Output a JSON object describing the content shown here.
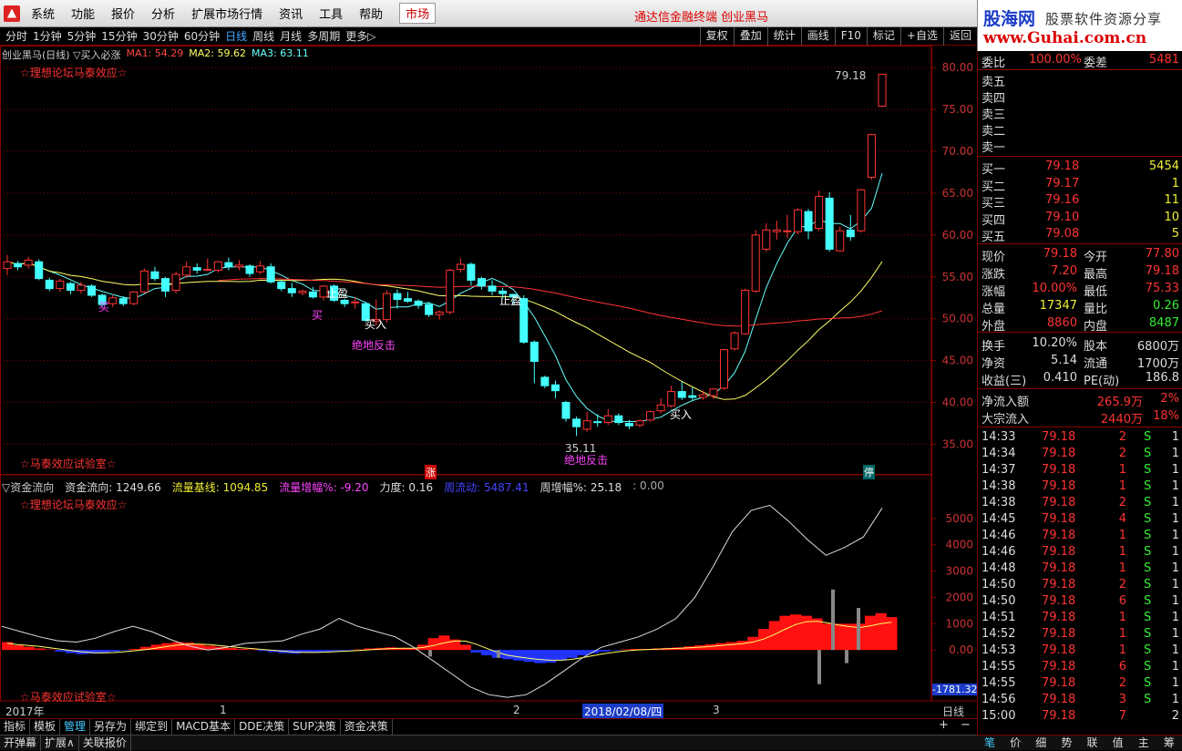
{
  "menubar": {
    "items": [
      "系统",
      "功能",
      "报价",
      "分析",
      "扩展市场行情",
      "资讯",
      "工具",
      "帮助"
    ],
    "active": "市场",
    "center_title": "通达信金融终端  创业黑马"
  },
  "brand": {
    "line1": "股海网",
    "line2": "股票软件资源分享",
    "line3": "www.Guhai.com.cn"
  },
  "toolbar": {
    "periods": [
      "分时",
      "1分钟",
      "5分钟",
      "15分钟",
      "30分钟",
      "60分钟",
      "日线",
      "周线",
      "月线",
      "多周期",
      "更多▷"
    ],
    "selected": "日线",
    "buttons": [
      "复权",
      "叠加",
      "统计",
      "画线",
      "F10",
      "标记",
      "+自选",
      "返回"
    ]
  },
  "main_chart": {
    "title": "创业黑马(日线) ▽买入必涨",
    "ma1": "MA1: 54.29",
    "ma2": "MA2: 59.62",
    "ma3": "MA3: 63.11",
    "tag_top": "☆理想论坛马泰效应☆",
    "tag_bottom": "☆马泰效应试验室☆",
    "high_label": "79.18",
    "low_label": "35.11",
    "annotations": [
      {
        "text": "止盈",
        "color": "#ffffff"
      },
      {
        "text": "止盈",
        "color": "#ffffff"
      },
      {
        "text": "买入",
        "color": "#ffffff"
      },
      {
        "text": "买入",
        "color": "#ffffff"
      },
      {
        "text": "绝地反击",
        "color": "#ff44ff"
      },
      {
        "text": "绝地反击",
        "color": "#ff44ff"
      },
      {
        "text": "买",
        "color": "#ff44ff"
      },
      {
        "text": "买",
        "color": "#ff44ff"
      }
    ],
    "mark_zhang": "涨",
    "mark_ting": "停",
    "y_labels": [
      "80.00",
      "75.00",
      "70.00",
      "65.00",
      "60.00",
      "55.00",
      "50.00",
      "45.00",
      "40.00",
      "35.00"
    ]
  },
  "sub_chart": {
    "title": "▽资金流向",
    "v1": "资金流向: 1249.66",
    "v2": "流量基线: 1094.85",
    "v3": "流量增幅%: -9.20",
    "v4": "力度: 0.16",
    "v5": "周流动: 5487.41",
    "v6": "周增幅%: 25.18",
    "v7": ": 0.00",
    "tag_top": "☆理想论坛马泰效应☆",
    "tag_bottom": "☆马泰效应试验室☆",
    "y_labels": [
      "5000",
      "4000",
      "3000",
      "2000",
      "1000",
      "0.00"
    ],
    "neg_label": "-1781.32"
  },
  "time_axis": {
    "labels": [
      "2017年",
      "1",
      "2",
      "2018/02/08/四",
      "3"
    ],
    "period": "日线"
  },
  "bottom_tabs": [
    "指标",
    "模板",
    "管理",
    "另存为",
    "绑定到",
    "MACD基本",
    "DDE决策",
    "SUP决策",
    "资金决策"
  ],
  "bottom_tabs_selected": "管理",
  "bottom_row2": [
    "开弹幕",
    "扩展∧",
    "关联报价"
  ],
  "quote": {
    "weibi": {
      "label": "委比",
      "value": "100.00%",
      "label2": "委差",
      "value2": "5481"
    },
    "asks": [
      {
        "label": "卖五"
      },
      {
        "label": "卖四"
      },
      {
        "label": "卖三"
      },
      {
        "label": "卖二"
      },
      {
        "label": "卖一"
      }
    ],
    "bids": [
      {
        "label": "买一",
        "price": "79.18",
        "vol": "5454"
      },
      {
        "label": "买二",
        "price": "79.17",
        "vol": "1"
      },
      {
        "label": "买三",
        "price": "79.16",
        "vol": "11"
      },
      {
        "label": "买四",
        "price": "79.10",
        "vol": "10"
      },
      {
        "label": "买五",
        "price": "79.08",
        "vol": "5"
      }
    ],
    "stats": [
      {
        "l1": "现价",
        "v1": "79.18",
        "c1": "red",
        "l2": "今开",
        "v2": "77.80",
        "c2": "red"
      },
      {
        "l1": "涨跌",
        "v1": "7.20",
        "c1": "red",
        "l2": "最高",
        "v2": "79.18",
        "c2": "red"
      },
      {
        "l1": "涨幅",
        "v1": "10.00%",
        "c1": "red",
        "l2": "最低",
        "v2": "75.33",
        "c2": "red"
      },
      {
        "l1": "总量",
        "v1": "17347",
        "c1": "yel",
        "l2": "量比",
        "v2": "0.26",
        "c2": "grn"
      },
      {
        "l1": "外盘",
        "v1": "8860",
        "c1": "red",
        "l2": "内盘",
        "v2": "8487",
        "c2": "grn"
      }
    ],
    "stats2": [
      {
        "l1": "换手",
        "v1": "10.20%",
        "l2": "股本",
        "v2": "6800万"
      },
      {
        "l1": "净资",
        "v1": "5.14",
        "l2": "流通",
        "v2": "1700万"
      },
      {
        "l1": "收益(三)",
        "v1": "0.410",
        "l2": "PE(动)",
        "v2": "186.8"
      }
    ],
    "flows": [
      {
        "label": "净流入额",
        "value": "265.9万",
        "pct": "2%"
      },
      {
        "label": "大宗流入",
        "value": "2440万",
        "pct": "18%"
      }
    ],
    "ticks": [
      {
        "t": "14:33",
        "p": "79.18",
        "v": "2",
        "s": "S",
        "n": "1"
      },
      {
        "t": "14:34",
        "p": "79.18",
        "v": "2",
        "s": "S",
        "n": "1"
      },
      {
        "t": "14:37",
        "p": "79.18",
        "v": "1",
        "s": "S",
        "n": "1"
      },
      {
        "t": "14:38",
        "p": "79.18",
        "v": "1",
        "s": "S",
        "n": "1"
      },
      {
        "t": "14:38",
        "p": "79.18",
        "v": "2",
        "s": "S",
        "n": "1"
      },
      {
        "t": "14:45",
        "p": "79.18",
        "v": "4",
        "s": "S",
        "n": "1"
      },
      {
        "t": "14:46",
        "p": "79.18",
        "v": "1",
        "s": "S",
        "n": "1"
      },
      {
        "t": "14:46",
        "p": "79.18",
        "v": "1",
        "s": "S",
        "n": "1"
      },
      {
        "t": "14:48",
        "p": "79.18",
        "v": "1",
        "s": "S",
        "n": "1"
      },
      {
        "t": "14:50",
        "p": "79.18",
        "v": "2",
        "s": "S",
        "n": "1"
      },
      {
        "t": "14:50",
        "p": "79.18",
        "v": "6",
        "s": "S",
        "n": "1"
      },
      {
        "t": "14:51",
        "p": "79.18",
        "v": "1",
        "s": "S",
        "n": "1"
      },
      {
        "t": "14:52",
        "p": "79.18",
        "v": "1",
        "s": "S",
        "n": "1"
      },
      {
        "t": "14:53",
        "p": "79.18",
        "v": "1",
        "s": "S",
        "n": "1"
      },
      {
        "t": "14:55",
        "p": "79.18",
        "v": "6",
        "s": "S",
        "n": "1"
      },
      {
        "t": "14:55",
        "p": "79.18",
        "v": "2",
        "s": "S",
        "n": "1"
      },
      {
        "t": "14:56",
        "p": "79.18",
        "v": "3",
        "s": "S",
        "n": "1"
      },
      {
        "t": "15:00",
        "p": "79.18",
        "v": "7",
        "s": "",
        "n": "2"
      }
    ]
  },
  "right_tabs": [
    "笔",
    "价",
    "细",
    "势",
    "联",
    "值",
    "主",
    "筹"
  ],
  "right_tabs_selected": "笔",
  "colors": {
    "up": "#ff3333",
    "down": "#44ffff",
    "ma1": "#ffffff",
    "ma2": "#ffff66",
    "ma3": "#ff3333",
    "grid": "#880000"
  },
  "chart_data": {
    "type": "candlestick",
    "y_range": [
      32,
      81
    ],
    "candles": [
      [
        56.0,
        56.8,
        55.2,
        57.6
      ],
      [
        56.6,
        56.2,
        55.8,
        56.9
      ],
      [
        56.4,
        57.0,
        56.0,
        57.4
      ],
      [
        56.8,
        54.8,
        54.6,
        57.1
      ],
      [
        54.6,
        53.6,
        53.3,
        54.9
      ],
      [
        53.6,
        54.5,
        53.2,
        54.8
      ],
      [
        54.2,
        53.4,
        52.9,
        54.4
      ],
      [
        53.4,
        54.0,
        53.0,
        54.4
      ],
      [
        53.9,
        52.8,
        52.6,
        54.1
      ],
      [
        52.8,
        51.7,
        51.4,
        53.0
      ],
      [
        51.8,
        52.5,
        51.4,
        52.8
      ],
      [
        52.4,
        51.8,
        51.5,
        52.7
      ],
      [
        51.8,
        53.2,
        51.6,
        53.3
      ],
      [
        53.2,
        55.7,
        53.0,
        56.0
      ],
      [
        55.6,
        54.8,
        54.5,
        56.2
      ],
      [
        54.8,
        53.3,
        52.6,
        55.0
      ],
      [
        53.4,
        55.3,
        53.0,
        55.6
      ],
      [
        55.2,
        56.2,
        54.9,
        56.8
      ],
      [
        56.1,
        55.8,
        55.4,
        56.6
      ],
      [
        55.9,
        55.9,
        55.7,
        57.2
      ],
      [
        55.8,
        56.8,
        55.5,
        56.9
      ],
      [
        56.7,
        56.2,
        55.8,
        57.3
      ],
      [
        56.2,
        56.4,
        55.8,
        57.0
      ],
      [
        56.3,
        55.4,
        55.0,
        56.5
      ],
      [
        55.6,
        56.3,
        55.3,
        56.9
      ],
      [
        56.2,
        54.4,
        54.2,
        56.6
      ],
      [
        54.4,
        53.6,
        53.3,
        54.6
      ],
      [
        53.6,
        53.1,
        52.6,
        54.3
      ],
      [
        53.1,
        53.3,
        52.8,
        53.5
      ],
      [
        53.2,
        52.6,
        52.4,
        53.8
      ],
      [
        52.6,
        53.9,
        52.2,
        54.0
      ],
      [
        53.9,
        52.2,
        52.0,
        54.1
      ],
      [
        52.2,
        51.8,
        51.4,
        52.4
      ],
      [
        51.9,
        52.0,
        51.2,
        52.6
      ],
      [
        51.8,
        49.8,
        49.6,
        52.0
      ],
      [
        49.7,
        49.9,
        49.2,
        52.3
      ],
      [
        49.9,
        53.0,
        49.5,
        53.4
      ],
      [
        53.0,
        52.3,
        51.2,
        53.5
      ],
      [
        52.4,
        52.1,
        51.9,
        53.2
      ],
      [
        52.1,
        51.6,
        51.2,
        52.3
      ],
      [
        51.7,
        50.5,
        50.2,
        52.0
      ],
      [
        50.5,
        50.8,
        49.9,
        51.0
      ],
      [
        50.8,
        55.8,
        50.5,
        56.0
      ],
      [
        55.9,
        56.5,
        55.5,
        57.2
      ],
      [
        56.5,
        54.6,
        54.0,
        56.7
      ],
      [
        54.8,
        53.9,
        53.5,
        55.0
      ],
      [
        53.9,
        53.3,
        52.8,
        54.6
      ],
      [
        53.3,
        53.0,
        52.4,
        53.7
      ],
      [
        52.9,
        52.6,
        51.7,
        53.0
      ],
      [
        52.4,
        47.2,
        47.0,
        52.8
      ],
      [
        47.2,
        44.9,
        42.3,
        47.4
      ],
      [
        43.0,
        42.0,
        41.7,
        43.2
      ],
      [
        42.1,
        41.4,
        40.5,
        42.6
      ],
      [
        40.0,
        38.1,
        37.7,
        40.2
      ],
      [
        38.0,
        37.1,
        36.0,
        38.3
      ],
      [
        36.8,
        37.8,
        36.5,
        38.9
      ],
      [
        37.7,
        37.6,
        37.1,
        38.6
      ],
      [
        37.6,
        38.4,
        37.3,
        39.2
      ],
      [
        38.4,
        37.6,
        37.3,
        38.7
      ],
      [
        37.5,
        37.2,
        36.8,
        37.9
      ],
      [
        37.3,
        37.8,
        37.0,
        38.0
      ],
      [
        37.9,
        38.9,
        37.7,
        39.0
      ],
      [
        39.0,
        39.7,
        38.7,
        40.5
      ],
      [
        39.6,
        41.3,
        39.4,
        42.0
      ],
      [
        41.3,
        40.6,
        40.3,
        42.5
      ],
      [
        40.8,
        40.6,
        40.3,
        41.8
      ],
      [
        40.6,
        40.9,
        40.3,
        41.4
      ],
      [
        40.8,
        41.6,
        40.4,
        41.7
      ],
      [
        41.7,
        46.3,
        41.5,
        46.4
      ],
      [
        46.4,
        48.3,
        46.2,
        48.5
      ],
      [
        48.2,
        53.4,
        48.1,
        53.6
      ],
      [
        53.3,
        60.0,
        53.1,
        60.6
      ],
      [
        58.3,
        60.6,
        58.0,
        61.4
      ],
      [
        60.4,
        60.6,
        59.4,
        61.7
      ],
      [
        60.4,
        60.5,
        59.6,
        62.4
      ],
      [
        60.4,
        63.0,
        60.1,
        63.2
      ],
      [
        62.8,
        60.5,
        59.5,
        63.1
      ],
      [
        60.8,
        64.6,
        60.5,
        65.3
      ],
      [
        64.4,
        58.3,
        58.0,
        65.1
      ],
      [
        58.1,
        60.5,
        58.0,
        61.0
      ],
      [
        60.6,
        59.8,
        59.3,
        62.4
      ],
      [
        60.5,
        65.4,
        60.3,
        65.5
      ],
      [
        66.9,
        72.0,
        66.6,
        72.1
      ],
      [
        75.4,
        79.2,
        75.3,
        79.2
      ]
    ],
    "ma_series_names": [
      "MA1",
      "MA2",
      "MA3"
    ],
    "flow_bars": [
      [
        300,
        "r"
      ],
      [
        180,
        "r"
      ],
      [
        120,
        "r"
      ],
      [
        60,
        "r"
      ],
      [
        20,
        "r"
      ],
      [
        -60,
        "b"
      ],
      [
        -120,
        "b"
      ],
      [
        -160,
        "b"
      ],
      [
        -140,
        "b"
      ],
      [
        -100,
        "b"
      ],
      [
        -60,
        "b"
      ],
      [
        -20,
        "b"
      ],
      [
        40,
        "r"
      ],
      [
        120,
        "r"
      ],
      [
        200,
        "r"
      ],
      [
        260,
        "r"
      ],
      [
        300,
        "r"
      ],
      [
        280,
        "r"
      ],
      [
        220,
        "r"
      ],
      [
        160,
        "r"
      ],
      [
        120,
        "r"
      ],
      [
        80,
        "r"
      ],
      [
        40,
        "r"
      ],
      [
        20,
        "r"
      ],
      [
        -40,
        "b"
      ],
      [
        -80,
        "b"
      ],
      [
        -120,
        "b"
      ],
      [
        -140,
        "b"
      ],
      [
        -100,
        "b"
      ],
      [
        -80,
        "b"
      ],
      [
        -60,
        "b"
      ],
      [
        -40,
        "b"
      ],
      [
        -20,
        "b"
      ],
      [
        20,
        "r"
      ],
      [
        60,
        "r"
      ],
      [
        80,
        "r"
      ],
      [
        100,
        "r"
      ],
      [
        80,
        "r"
      ],
      [
        60,
        "r"
      ],
      [
        200,
        "r"
      ],
      [
        450,
        "r"
      ],
      [
        550,
        "r"
      ],
      [
        400,
        "r"
      ],
      [
        200,
        "r"
      ],
      [
        -100,
        "b"
      ],
      [
        -200,
        "b"
      ],
      [
        -300,
        "b"
      ],
      [
        -350,
        "b"
      ],
      [
        -400,
        "b"
      ],
      [
        -450,
        "b"
      ],
      [
        -500,
        "b"
      ],
      [
        -480,
        "b"
      ],
      [
        -400,
        "b"
      ],
      [
        -300,
        "b"
      ],
      [
        -200,
        "b"
      ],
      [
        -120,
        "b"
      ],
      [
        -60,
        "b"
      ],
      [
        -20,
        "b"
      ],
      [
        20,
        "r"
      ],
      [
        40,
        "r"
      ],
      [
        40,
        "r"
      ],
      [
        60,
        "r"
      ],
      [
        80,
        "r"
      ],
      [
        100,
        "r"
      ],
      [
        140,
        "r"
      ],
      [
        180,
        "r"
      ],
      [
        220,
        "r"
      ],
      [
        260,
        "r"
      ],
      [
        300,
        "r"
      ],
      [
        350,
        "r"
      ],
      [
        500,
        "r"
      ],
      [
        800,
        "r"
      ],
      [
        1100,
        "r"
      ],
      [
        1300,
        "r"
      ],
      [
        1350,
        "r"
      ],
      [
        1300,
        "r"
      ],
      [
        1200,
        "r"
      ],
      [
        1000,
        "r"
      ],
      [
        1000,
        "r"
      ],
      [
        1000,
        "r"
      ],
      [
        1000,
        "r"
      ],
      [
        1300,
        "r"
      ],
      [
        1400,
        "r"
      ],
      [
        1250,
        "r"
      ]
    ],
    "flow_range": [
      -1900,
      6000
    ]
  }
}
